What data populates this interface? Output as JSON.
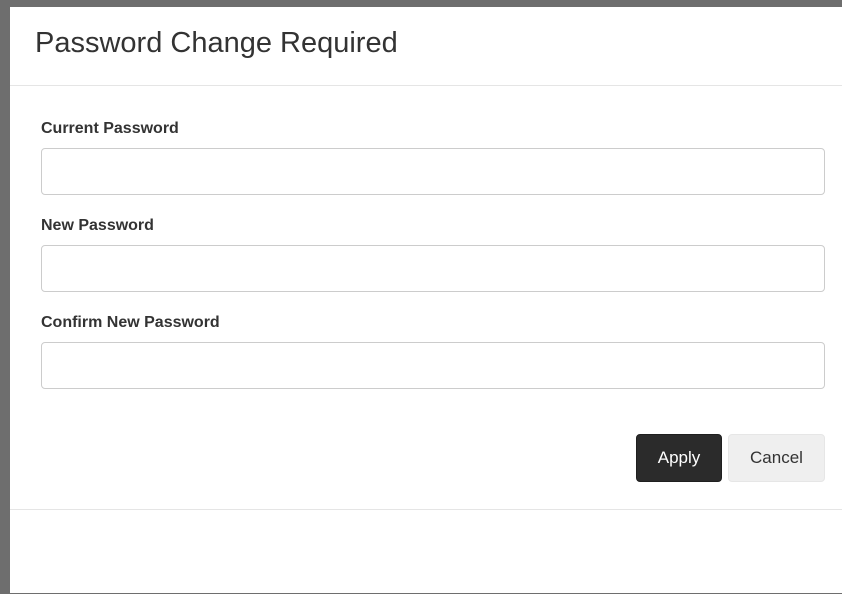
{
  "dialog": {
    "title": "Password Change Required"
  },
  "form": {
    "fields": [
      {
        "label": "Current Password",
        "value": "",
        "placeholder": ""
      },
      {
        "label": "New Password",
        "value": "",
        "placeholder": ""
      },
      {
        "label": "Confirm New Password",
        "value": "",
        "placeholder": ""
      }
    ]
  },
  "actions": {
    "apply_label": "Apply",
    "cancel_label": "Cancel"
  }
}
